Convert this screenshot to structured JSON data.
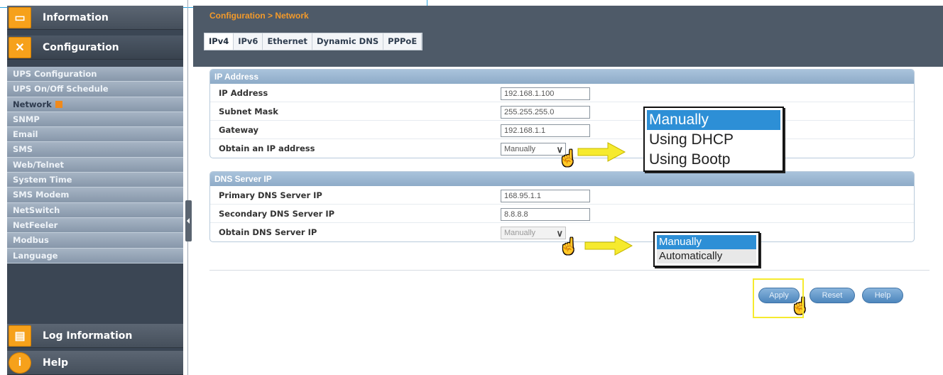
{
  "sidebar": {
    "sections": [
      {
        "label": "Information",
        "icon": "info-panel-icon"
      },
      {
        "label": "Configuration",
        "icon": "tools-icon"
      },
      {
        "label": "Log Information",
        "icon": "log-folder-icon"
      },
      {
        "label": "Help",
        "icon": "help-icon"
      }
    ],
    "items": [
      {
        "label": "UPS Configuration"
      },
      {
        "label": "UPS On/Off Schedule"
      },
      {
        "label": "Network"
      },
      {
        "label": "SNMP"
      },
      {
        "label": "Email"
      },
      {
        "label": "SMS"
      },
      {
        "label": "Web/Telnet"
      },
      {
        "label": "System Time"
      },
      {
        "label": "SMS Modem"
      },
      {
        "label": "NetSwitch"
      },
      {
        "label": "NetFeeler"
      },
      {
        "label": "Modbus"
      },
      {
        "label": "Language"
      }
    ]
  },
  "header": {
    "breadcrumb": "Configuration > Network"
  },
  "tabs": [
    {
      "label": "IPv4"
    },
    {
      "label": "IPv6"
    },
    {
      "label": "Ethernet"
    },
    {
      "label": "Dynamic DNS"
    },
    {
      "label": "PPPoE"
    }
  ],
  "ip_section": {
    "title": "IP Address",
    "rows": {
      "ip_address": {
        "label": "IP Address",
        "value": "192.168.1.100"
      },
      "subnet_mask": {
        "label": "Subnet Mask",
        "value": "255.255.255.0"
      },
      "gateway": {
        "label": "Gateway",
        "value": "192.168.1.1"
      },
      "obtain_ip": {
        "label": "Obtain an IP address",
        "value": "Manually"
      }
    },
    "dropdown_options": [
      "Manually",
      "Using DHCP",
      "Using Bootp"
    ]
  },
  "dns_section": {
    "title": "DNS Server IP",
    "rows": {
      "primary": {
        "label": "Primary DNS Server IP",
        "value": "168.95.1.1"
      },
      "secondary": {
        "label": "Secondary DNS Server IP",
        "value": "8.8.8.8"
      },
      "obtain_dns": {
        "label": "Obtain DNS Server IP",
        "value": "Manually"
      }
    },
    "dropdown_options": [
      "Manually",
      "Automatically"
    ]
  },
  "buttons": {
    "apply": "Apply",
    "reset": "Reset",
    "help": "Help"
  },
  "colors": {
    "accent_orange": "#f39a2a",
    "selection_blue": "#2d8fd6",
    "highlight_yellow": "#f6ea2e",
    "panel_header": "#9ab6d2"
  }
}
